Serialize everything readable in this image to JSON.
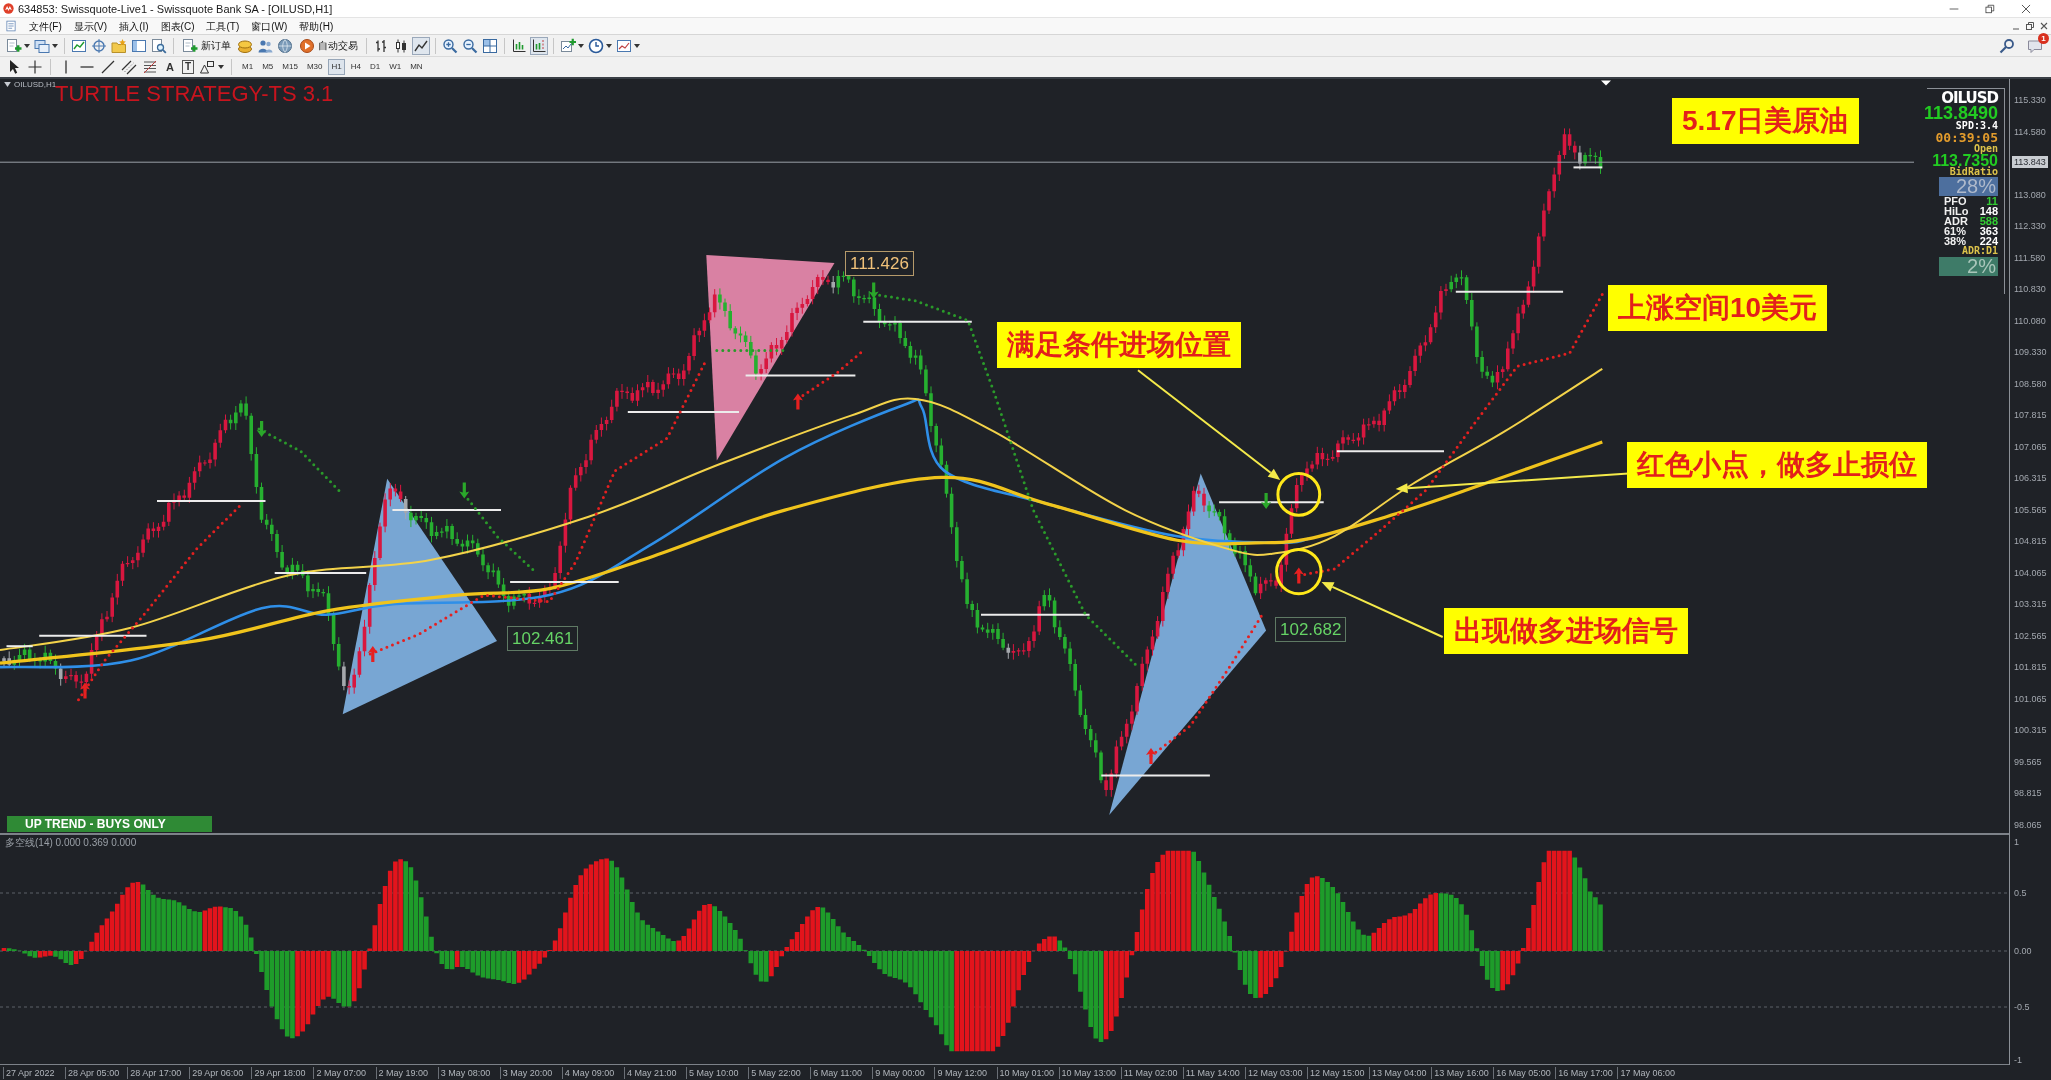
{
  "window": {
    "title": "634853: Swissquote-Live1 - Swissquote Bank SA - [OILUSD,H1]"
  },
  "menu": {
    "items": [
      "文件(F)",
      "显示(V)",
      "插入(I)",
      "图表(C)",
      "工具(T)",
      "窗口(W)",
      "帮助(H)"
    ]
  },
  "toolbar": {
    "new_order": "新订单",
    "auto_trading": "自动交易",
    "chart_types": [
      {
        "kind": "bars",
        "selected": false
      },
      {
        "kind": "candles",
        "selected": false
      },
      {
        "kind": "line",
        "selected": true
      }
    ],
    "auto_scroll": false,
    "chart_shift": true,
    "notification_count": "1"
  },
  "drawing_toolbar": {
    "text_tool": "A",
    "label_tool": "T",
    "timeframes": [
      {
        "label": "M1",
        "selected": false
      },
      {
        "label": "M5",
        "selected": false
      },
      {
        "label": "M15",
        "selected": false
      },
      {
        "label": "M30",
        "selected": false
      },
      {
        "label": "H1",
        "selected": true
      },
      {
        "label": "H4",
        "selected": false
      },
      {
        "label": "D1",
        "selected": false
      },
      {
        "label": "W1",
        "selected": false
      },
      {
        "label": "MN",
        "selected": false
      }
    ]
  },
  "chart": {
    "symbol_label": "OILUSD,H1",
    "title": "TURTLE STRATEGY-TS 3.1",
    "price_labels": [
      {
        "text": "111.426",
        "kind": "high"
      },
      {
        "text": "102.461",
        "kind": "low"
      },
      {
        "text": "102.682",
        "kind": "low"
      }
    ],
    "annotations": [
      "5.17日美原油",
      "上涨空间10美元",
      "满足条件进场位置",
      "红色小点，做多止损位",
      "出现做多进场信号"
    ],
    "trend_badge": "UP TREND - BUYS ONLY",
    "info_panel": {
      "symbol": "OILUSD",
      "bid": "113.8490",
      "spread": "SPD:3.4",
      "timer": "00:39:05",
      "open_label": "Open",
      "open": "113.7350",
      "bid_ratio_label": "BidRatio",
      "bid_ratio": "28%",
      "stats": [
        {
          "label": "PFO",
          "value": "11",
          "color": "#33cc33"
        },
        {
          "label": "HiLo",
          "value": "148",
          "color": "#ffffff"
        },
        {
          "label": "ADR",
          "value": "588",
          "color": "#33cc33"
        },
        {
          "label": "61%",
          "value": "363",
          "color": "#ffffff"
        },
        {
          "label": "38%",
          "value": "224",
          "color": "#ffffff"
        }
      ],
      "adr_label": "ADR:D1",
      "adr_percent": "2%"
    },
    "price_axis": {
      "labels": [
        "115.330",
        "114.580",
        "113.080",
        "112.330",
        "111.580",
        "110.830",
        "110.080",
        "109.330",
        "108.580",
        "107.815",
        "107.065",
        "106.315",
        "105.565",
        "104.815",
        "104.065",
        "103.315",
        "102.565",
        "101.815",
        "101.065",
        "100.315",
        "99.565",
        "98.815",
        "98.065"
      ],
      "current_price": "113.843"
    },
    "indicator": {
      "label": "多空线(14) 0.000 0.369 0.000",
      "axis_labels": [
        "1",
        "0.5",
        "0.00",
        "-0.5",
        "-1"
      ]
    },
    "time_axis": {
      "labels": [
        "27 Apr 2022",
        "28 Apr 05:00",
        "28 Apr 17:00",
        "29 Apr 06:00",
        "29 Apr 18:00",
        "2 May 07:00",
        "2 May 19:00",
        "3 May 08:00",
        "3 May 20:00",
        "4 May 09:00",
        "4 May 21:00",
        "5 May 10:00",
        "5 May 22:00",
        "6 May 11:00",
        "9 May 00:00",
        "9 May 12:00",
        "10 May 01:00",
        "10 May 13:00",
        "11 May 02:00",
        "11 May 14:00",
        "12 May 03:00",
        "12 May 15:00",
        "13 May 04:00",
        "13 May 16:00",
        "16 May 05:00",
        "16 May 17:00",
        "17 May 06:00"
      ]
    }
  }
}
